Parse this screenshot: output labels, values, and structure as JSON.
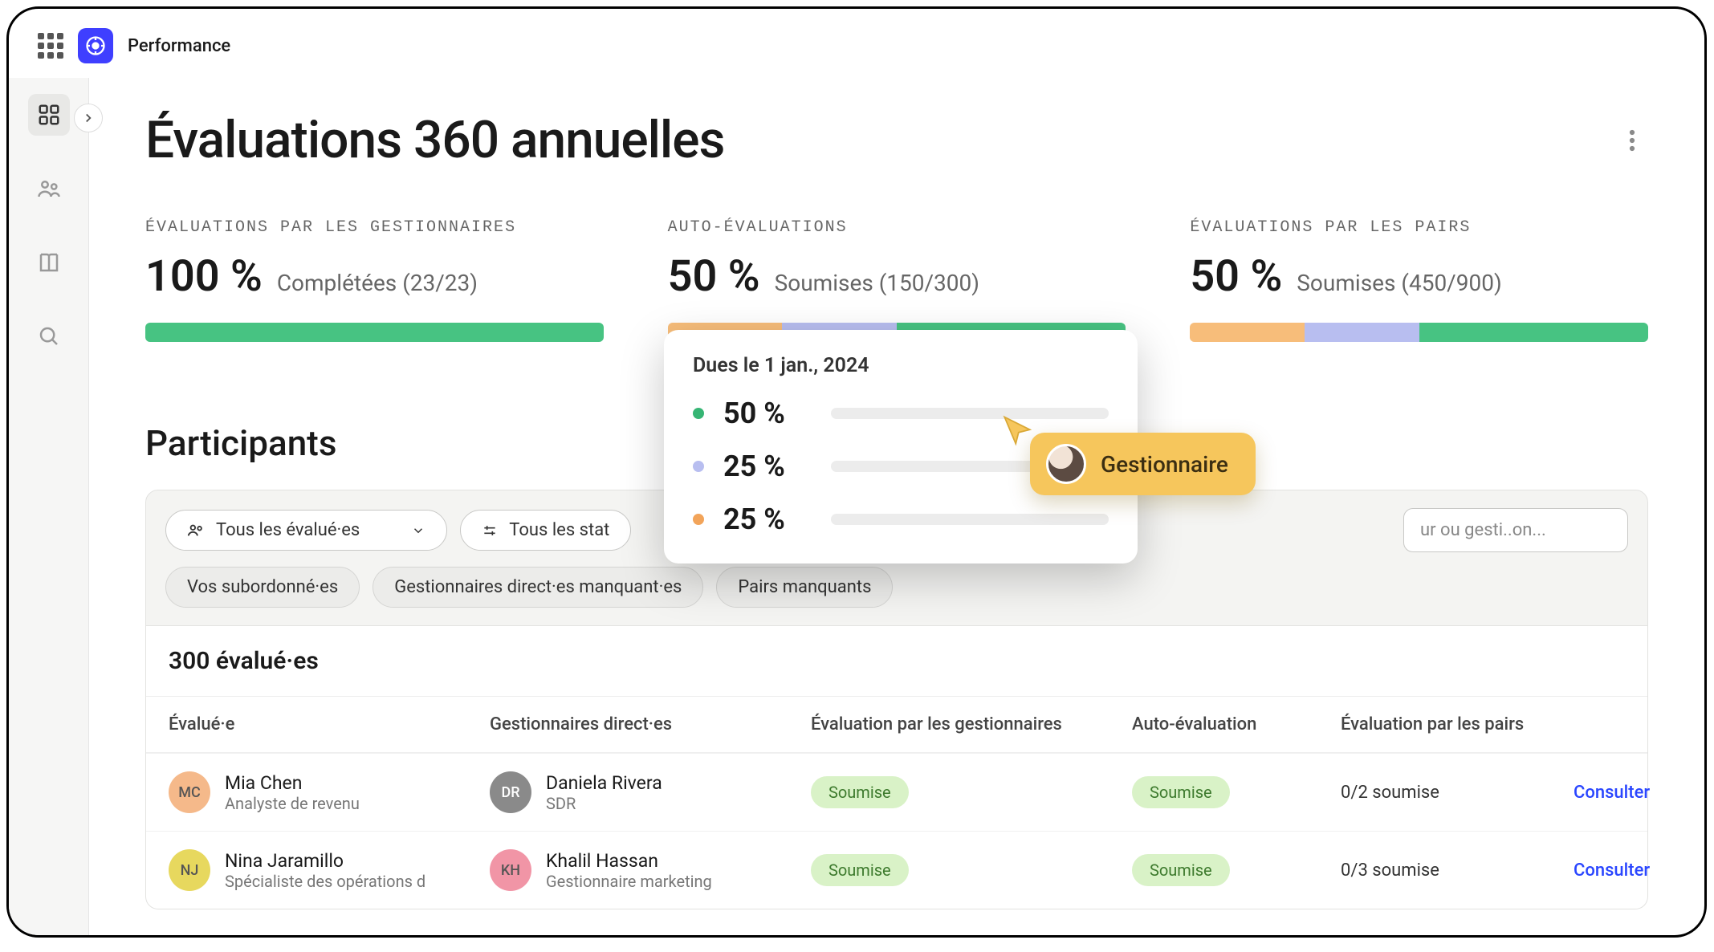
{
  "app_name": "Performance",
  "page_title": "Évaluations 360 annuelles",
  "kpis": [
    {
      "label": "ÉVALUATIONS PAR LES GESTIONNAIRES",
      "value": "100 %",
      "status": "Complétées (23/23)",
      "segments": [
        {
          "color": "green",
          "pct": 100
        }
      ]
    },
    {
      "label": "AUTO-ÉVALUATIONS",
      "value": "50 %",
      "status": "Soumises (150/300)",
      "segments": [
        {
          "color": "orange",
          "pct": 25
        },
        {
          "color": "blue",
          "pct": 25
        },
        {
          "color": "green",
          "pct": 50
        }
      ]
    },
    {
      "label": "ÉVALUATIONS PAR LES PAIRS",
      "value": "50 %",
      "status": "Soumises (450/900)",
      "segments": [
        {
          "color": "orange",
          "pct": 25
        },
        {
          "color": "blue",
          "pct": 25
        },
        {
          "color": "green",
          "pct": 50
        }
      ]
    }
  ],
  "popover": {
    "title": "Dues le 1 jan., 2024",
    "rows": [
      {
        "color": "#36b574",
        "value": "50 %"
      },
      {
        "color": "#b8bef0",
        "value": "25 %"
      },
      {
        "color": "#f2a45a",
        "value": "25 %"
      }
    ]
  },
  "cursor_label": "Gestionnaire",
  "participants_title": "Participants",
  "filters": {
    "evaluees": "Tous les évalué·es",
    "statuses": "Tous les stat",
    "search_placeholder": "ur ou gesti..on..."
  },
  "chips": [
    "Vos subordonné·es",
    "Gestionnaires direct·es manquant·es",
    "Pairs manquants"
  ],
  "table": {
    "count_label": "300 évalué·es",
    "columns": [
      "Évalué·e",
      "Gestionnaires direct·es",
      "Évaluation par les gestionnaires",
      "Auto-évaluation",
      "Évaluation par les pairs",
      ""
    ],
    "rows": [
      {
        "evaluee": {
          "initials": "MC",
          "name": "Mia Chen",
          "role": "Analyste de revenu",
          "bg": "#f5b98a"
        },
        "manager": {
          "initials": "DR",
          "name": "Daniela Rivera",
          "role": "SDR",
          "bg": "#8a8a8a",
          "fg": "#fff"
        },
        "mgr_eval": "Soumise",
        "self_eval": "Soumise",
        "peer": "0/2 soumise",
        "action": "Consulter"
      },
      {
        "evaluee": {
          "initials": "NJ",
          "name": "Nina Jaramillo",
          "role": "Spécialiste des opérations d",
          "bg": "#e7d85e"
        },
        "manager": {
          "initials": "KH",
          "name": "Khalil Hassan",
          "role": "Gestionnaire marketing",
          "bg": "#f195a6"
        },
        "mgr_eval": "Soumise",
        "self_eval": "Soumise",
        "peer": "0/3 soumise",
        "action": "Consulter"
      }
    ]
  },
  "chart_data": [
    {
      "type": "bar",
      "title": "ÉVALUATIONS PAR LES GESTIONNAIRES",
      "categories": [
        "Complétées"
      ],
      "values": [
        100
      ],
      "ylim": [
        0,
        100
      ],
      "ylabel": "%",
      "annotation": "23/23"
    },
    {
      "type": "bar",
      "title": "AUTO-ÉVALUATIONS",
      "categories": [
        "Orange",
        "Bleu",
        "Vert (Soumises)"
      ],
      "values": [
        25,
        25,
        50
      ],
      "ylim": [
        0,
        100
      ],
      "ylabel": "%",
      "annotation": "150/300"
    },
    {
      "type": "bar",
      "title": "ÉVALUATIONS PAR LES PAIRS",
      "categories": [
        "Orange",
        "Bleu",
        "Vert (Soumises)"
      ],
      "values": [
        25,
        25,
        50
      ],
      "ylim": [
        0,
        100
      ],
      "ylabel": "%",
      "annotation": "450/900"
    },
    {
      "type": "bar",
      "title": "Dues le 1 jan., 2024",
      "categories": [
        "Vert",
        "Bleu",
        "Orange"
      ],
      "values": [
        50,
        25,
        25
      ],
      "ylim": [
        0,
        100
      ],
      "ylabel": "%"
    }
  ]
}
